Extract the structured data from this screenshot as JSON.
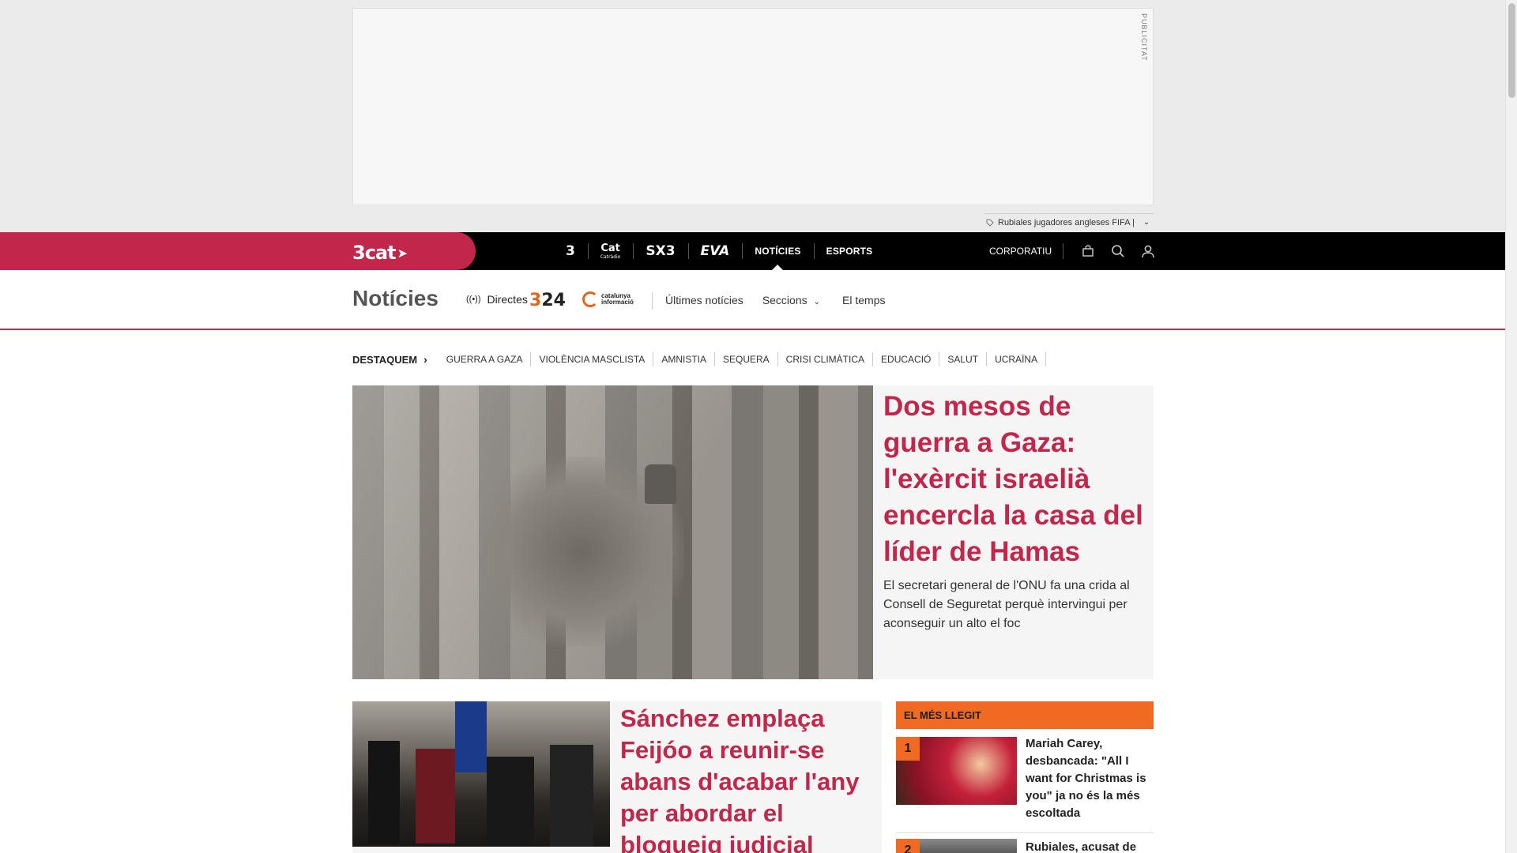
{
  "ad": {
    "label": "PUBLICITAT",
    "tag_text": "Rubiales jugadores angleses FIFA |"
  },
  "topbar": {
    "brand": "3cat",
    "channels": [
      {
        "label": "3",
        "name": "tv3"
      },
      {
        "label": "Cat",
        "sub": "Catràdio",
        "name": "catradio"
      },
      {
        "label": "SX3",
        "name": "sx3"
      },
      {
        "label": "EVA",
        "name": "eva"
      },
      {
        "label": "NOTÍCIES",
        "name": "noticies"
      },
      {
        "label": "ESPORTS",
        "name": "esports"
      }
    ],
    "corporatiu": "CORPORATIU"
  },
  "secnav": {
    "title": "Notícies",
    "directes": "Directes",
    "logo_324": "24",
    "logo_324_prefix": "3",
    "logo_ci": "catalunya informació",
    "links": {
      "ultimes": "Últimes notícies",
      "seccions": "Seccions",
      "temps": "El temps"
    }
  },
  "tags": {
    "lead": "DESTAQUEM",
    "items": [
      "GUERRA A GAZA",
      "VIOLÈNCIA MASCLISTA",
      "AMNISTIA",
      "SEQUERA",
      "CRISI CLIMÀTICA",
      "EDUCACIÓ",
      "SALUT",
      "UCRAÏNA"
    ]
  },
  "hero": {
    "title": "Dos mesos de guerra a Gaza: l'exèrcit israelià encercla la casa del líder de Hamas",
    "subtitle": "El secretari general de l'ONU fa una crida al Consell de Seguretat perquè intervingui per aconseguir un alto el foc"
  },
  "article2": {
    "title": "Sánchez emplaça Feijóo a reunir-se abans d'acabar l'any per abordar el bloqueig judicial"
  },
  "mostread": {
    "heading": "EL MÉS LLEGIT",
    "items": [
      {
        "num": "1",
        "title": "Mariah Carey, desbancada: \"All I want for Christmas is you\" ja no és la més escoltada"
      },
      {
        "num": "2",
        "title": "Rubiales, acusat de"
      }
    ]
  },
  "colors": {
    "brand": "#c2264a",
    "accent_orange": "#f06b21",
    "topbar_bg": "#000000"
  }
}
